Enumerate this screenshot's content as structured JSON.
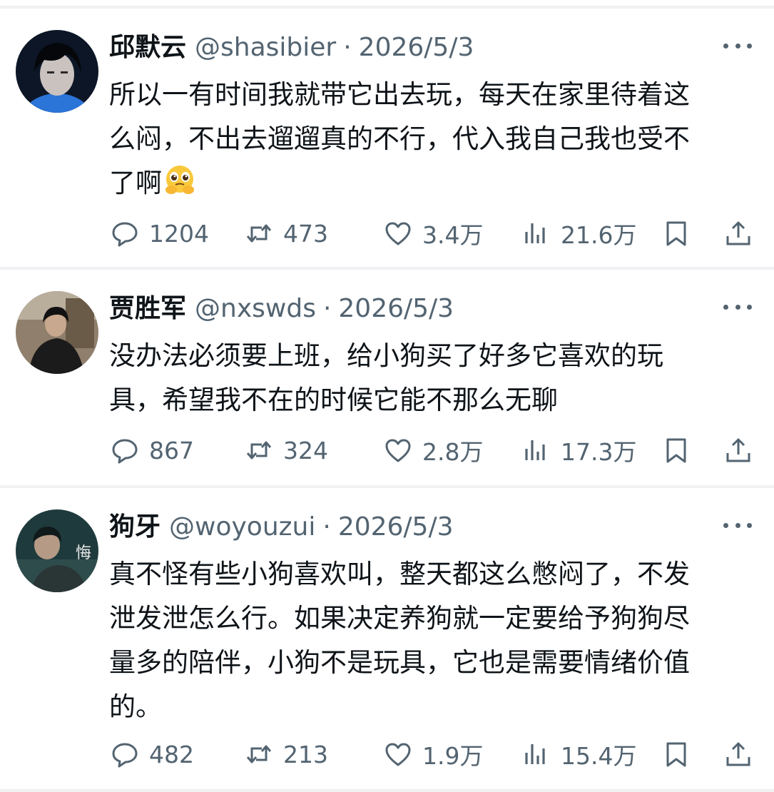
{
  "tweets": [
    {
      "name": "邱默云",
      "handle": "@shasibier",
      "separator": "·",
      "date": "2026/5/3",
      "lines": [
        "所以一有时间我就带它出去玩，每天在家里待着这",
        "么闷，不出去遛遛真的不行，代入我自己我也受不",
        "了啊"
      ],
      "emoji": "pleading-hands-emoji",
      "replies": "1204",
      "retweets": "473",
      "likes": "3.4万",
      "views": "21.6万"
    },
    {
      "name": "贾胜军",
      "handle": "@nxswds",
      "separator": "·",
      "date": "2026/5/3",
      "lines": [
        "没办法必须要上班，给小狗买了好多它喜欢的玩",
        "具，希望我不在的时候它能不那么无聊"
      ],
      "replies": "867",
      "retweets": "324",
      "likes": "2.8万",
      "views": "17.3万"
    },
    {
      "name": "狗牙",
      "handle": "@woyouzui",
      "separator": "·",
      "date": "2026/5/3",
      "lines": [
        "真不怪有些小狗喜欢叫，整天都这么憋闷了，不发",
        "泄发泄怎么行。如果决定养狗就一定要给予狗狗尽",
        "量多的陪伴，小狗不是玩具，它也是需要情绪价值",
        "的。"
      ],
      "avatar_text": "悔",
      "replies": "482",
      "retweets": "213",
      "likes": "1.9万",
      "views": "15.4万"
    }
  ],
  "icons": {
    "reply": "reply-bubble-icon",
    "retweet": "retweet-icon",
    "like": "heart-icon",
    "views": "views-bar-chart-icon",
    "bookmark": "bookmark-icon",
    "share": "share-upload-icon",
    "more": "more-dots-icon"
  },
  "colors": {
    "text": "#0f1419",
    "secondary": "#536471",
    "divider": "#eff1f3"
  }
}
